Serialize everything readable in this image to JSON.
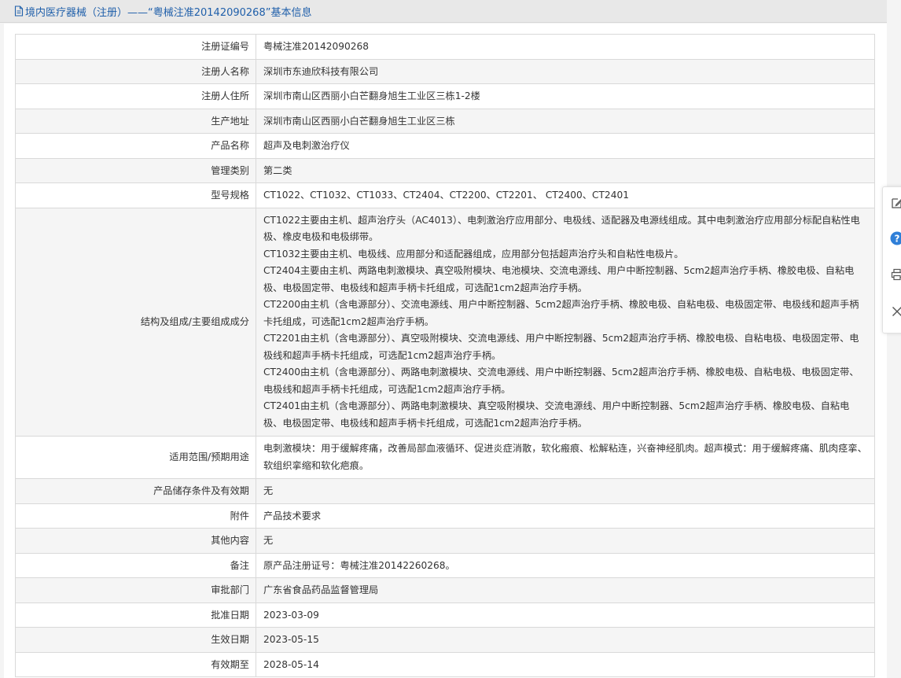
{
  "header": {
    "title": "境内医疗器械（注册）——“粤械注准20142090268”基本信息",
    "icon": "document-icon"
  },
  "rows": [
    {
      "label": "注册证编号",
      "value": "粤械注准20142090268"
    },
    {
      "label": "注册人名称",
      "value": "深圳市东迪欣科技有限公司"
    },
    {
      "label": "注册人住所",
      "value": "深圳市南山区西丽小白芒翻身旭生工业区三栋1-2楼"
    },
    {
      "label": "生产地址",
      "value": "深圳市南山区西丽小白芒翻身旭生工业区三栋"
    },
    {
      "label": "产品名称",
      "value": "超声及电刺激治疗仪"
    },
    {
      "label": "管理类别",
      "value": "第二类"
    },
    {
      "label": "型号规格",
      "value": "CT1022、CT1032、CT1033、CT2404、CT2200、CT2201、 CT2400、CT2401"
    },
    {
      "label": "结构及组成/主要组成成分",
      "paragraphs": [
        "CT1022主要由主机、超声治疗头（AC4013）、电刺激治疗应用部分、电极线、适配器及电源线组成。其中电刺激治疗应用部分标配自粘性电极、橡皮电极和电极绑带。",
        "CT1032主要由主机、电极线、应用部分和适配器组成，应用部分包括超声治疗头和自粘性电极片。",
        "CT2404主要由主机、两路电刺激模块、真空吸附模块、电池模块、交流电源线、用户中断控制器、5cm2超声治疗手柄、橡胶电极、自粘电极、电极固定带、电极线和超声手柄卡托组成，可选配1cm2超声治疗手柄。",
        "CT2200由主机（含电源部分）、交流电源线、用户中断控制器、5cm2超声治疗手柄、橡胶电极、自粘电极、电极固定带、电极线和超声手柄卡托组成，可选配1cm2超声治疗手柄。",
        "CT2201由主机（含电源部分）、真空吸附模块、交流电源线、用户中断控制器、5cm2超声治疗手柄、橡胶电极、自粘电极、电极固定带、电极线和超声手柄卡托组成，可选配1cm2超声治疗手柄。",
        "CT2400由主机（含电源部分）、两路电刺激模块、交流电源线、用户中断控制器、5cm2超声治疗手柄、橡胶电极、自粘电极、电极固定带、电极线和超声手柄卡托组成，可选配1cm2超声治疗手柄。",
        "CT2401由主机（含电源部分）、两路电刺激模块、真空吸附模块、交流电源线、用户中断控制器、5cm2超声治疗手柄、橡胶电极、自粘电极、电极固定带、电极线和超声手柄卡托组成，可选配1cm2超声治疗手柄。"
      ]
    },
    {
      "label": "适用范围/预期用途",
      "value": "电刺激模块：用于缓解疼痛，改善局部血液循环、促进炎症消散，软化瘢痕、松解粘连，兴奋神经肌肉。超声模式：用于缓解疼痛、肌肉痉挛、软组织挛缩和软化疤痕。"
    },
    {
      "label": "产品储存条件及有效期",
      "value": "无"
    },
    {
      "label": "附件",
      "value": "产品技术要求"
    },
    {
      "label": "其他内容",
      "value": "无"
    },
    {
      "label": "备注",
      "value": "原产品注册证号：粤械注准20142260268。"
    },
    {
      "label": "审批部门",
      "value": "广东省食品药品监督管理局"
    },
    {
      "label": "批准日期",
      "value": "2023-03-09"
    },
    {
      "label": "生效日期",
      "value": "2023-05-15"
    },
    {
      "label": "有效期至",
      "value": "2028-05-14"
    }
  ],
  "float_toolbar": [
    {
      "icon": "edit-icon"
    },
    {
      "icon": "help-icon"
    },
    {
      "icon": "print-icon"
    },
    {
      "icon": "close-icon"
    }
  ],
  "colors": {
    "title": "#1f5faa",
    "border": "#d9d9d9",
    "shade": "#f5f5f5",
    "help": "#2f7fd8"
  }
}
